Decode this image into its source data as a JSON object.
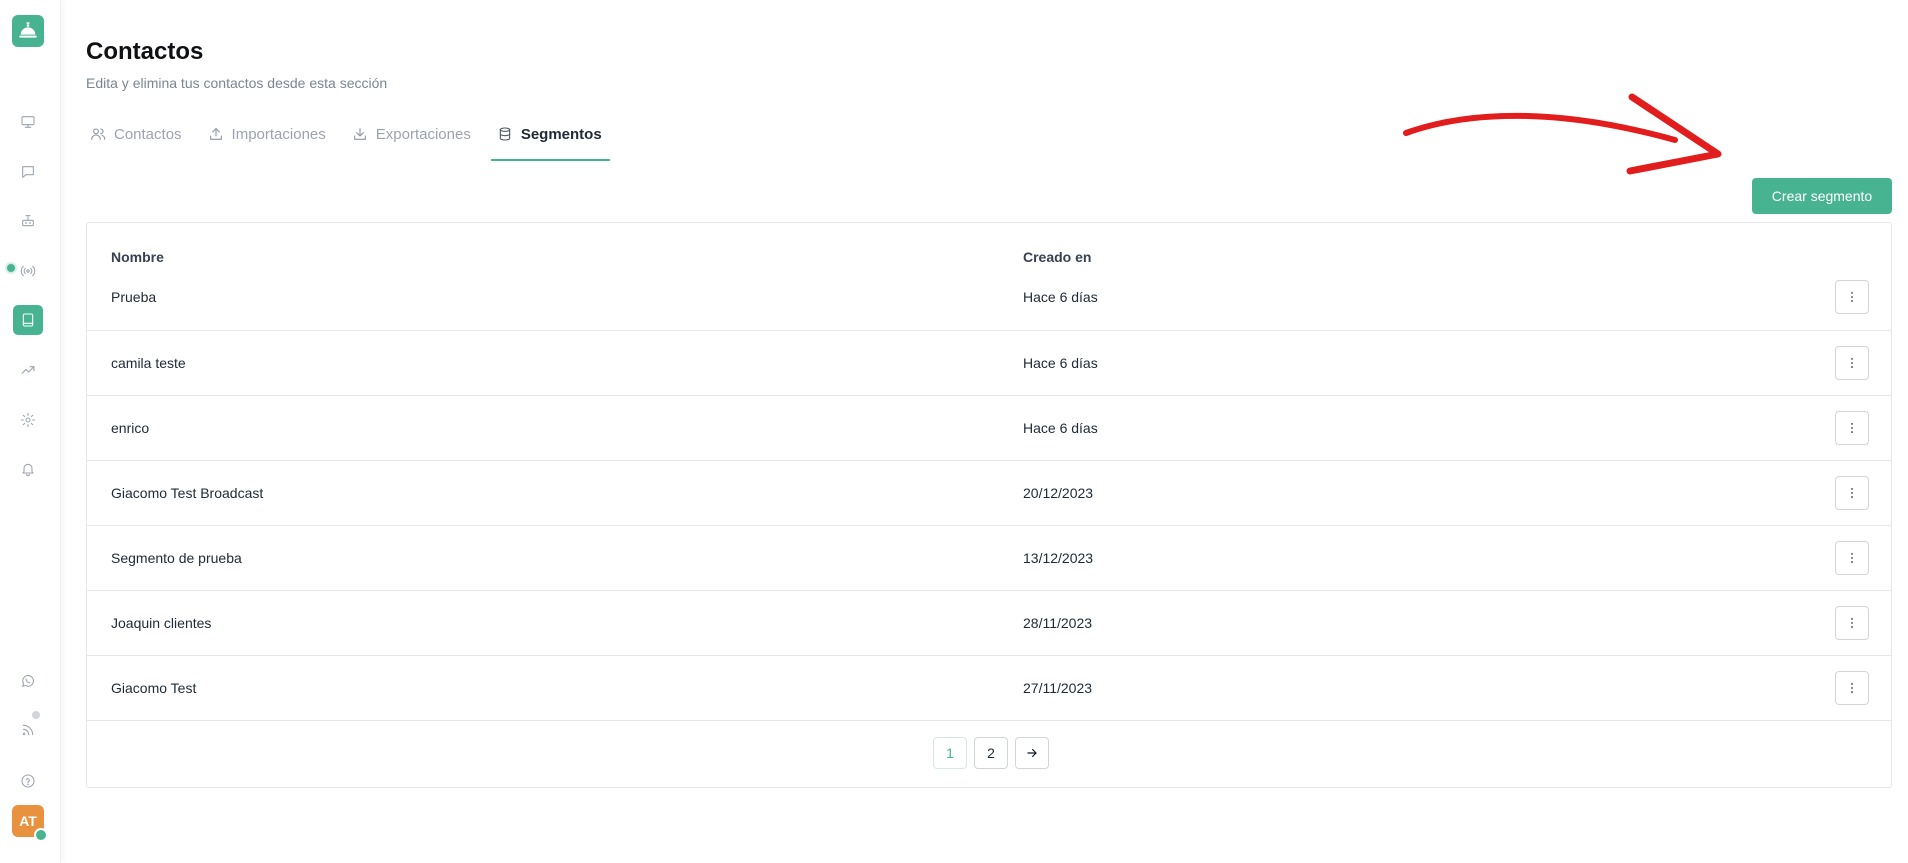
{
  "header": {
    "title": "Contactos",
    "subtitle": "Edita y elimina tus contactos desde esta sección"
  },
  "sidebar": {
    "logo_icon": "service-bell-icon",
    "items": [
      {
        "icon": "monitor-icon",
        "active": false
      },
      {
        "icon": "chat-icon",
        "active": false
      },
      {
        "icon": "bot-icon",
        "active": false
      },
      {
        "icon": "broadcast-icon",
        "active": false
      },
      {
        "icon": "contacts-book-icon",
        "active": true
      },
      {
        "icon": "trending-up-icon",
        "active": false
      },
      {
        "icon": "gear-icon",
        "active": false
      },
      {
        "icon": "bell-icon",
        "active": false
      }
    ],
    "bottom_items": [
      {
        "icon": "whatsapp-icon"
      },
      {
        "icon": "rss-icon"
      },
      {
        "icon": "help-icon"
      }
    ],
    "avatar_initials": "AT"
  },
  "tabs": [
    {
      "label": "Contactos",
      "icon": "users-icon",
      "active": false
    },
    {
      "label": "Importaciones",
      "icon": "upload-icon",
      "active": false
    },
    {
      "label": "Exportaciones",
      "icon": "download-icon",
      "active": false
    },
    {
      "label": "Segmentos",
      "icon": "database-icon",
      "active": true
    }
  ],
  "actions": {
    "create_label": "Crear segmento"
  },
  "table": {
    "columns": [
      "Nombre",
      "Creado en"
    ],
    "rows": [
      {
        "name": "Prueba",
        "created": "Hace 6 días"
      },
      {
        "name": "camila teste",
        "created": "Hace 6 días"
      },
      {
        "name": "enrico",
        "created": "Hace 6 días"
      },
      {
        "name": "Giacomo Test Broadcast",
        "created": "20/12/2023"
      },
      {
        "name": "Segmento de prueba",
        "created": "13/12/2023"
      },
      {
        "name": "Joaquin clientes",
        "created": "28/11/2023"
      },
      {
        "name": "Giacomo Test",
        "created": "27/11/2023"
      }
    ]
  },
  "pagination": {
    "pages": [
      "1",
      "2"
    ],
    "current": "1",
    "next_icon": "arrow-right-icon"
  },
  "colors": {
    "accent": "#47b391",
    "annotation": "#e11d1d",
    "avatar": "#e8913f"
  }
}
